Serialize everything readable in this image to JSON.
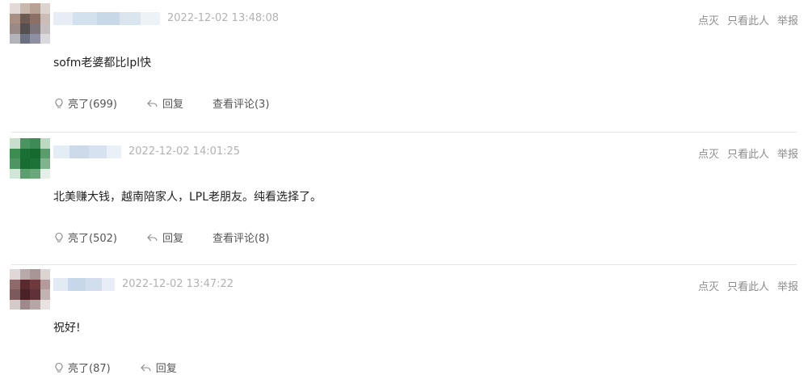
{
  "comments": [
    {
      "timestamp": "2022-12-02 13:48:08",
      "content": "sofm老婆都比lpl快",
      "like_label": "亮了(699)",
      "reply_label": "回复",
      "view_comments_label": "查看评论(3)",
      "top_actions": [
        "点灭",
        "只看此人",
        "举报"
      ]
    },
    {
      "timestamp": "2022-12-02 14:01:25",
      "content": "北美赚大钱，越南陪家人，LPL老朋友。纯看选择了。",
      "like_label": "亮了(502)",
      "reply_label": "回复",
      "view_comments_label": "查看评论(8)",
      "top_actions": [
        "点灭",
        "只看此人",
        "举报"
      ]
    },
    {
      "timestamp": "2022-12-02 13:47:22",
      "content": "祝好!",
      "like_label": "亮了(87)",
      "reply_label": "回复",
      "top_actions": [
        "点灭",
        "只看此人",
        "举报"
      ]
    }
  ]
}
